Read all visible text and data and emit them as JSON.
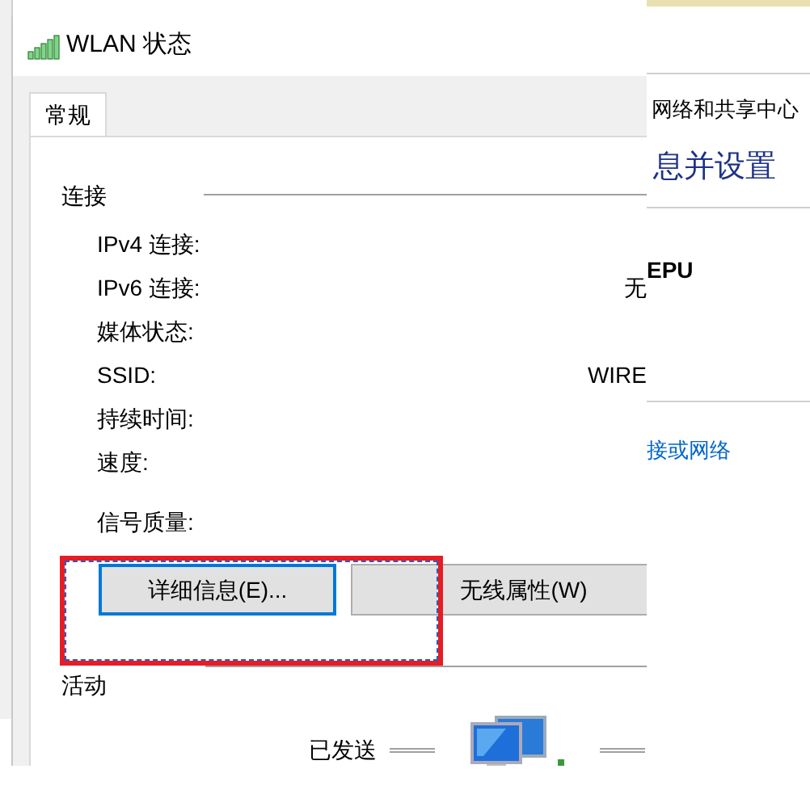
{
  "background_window": {
    "title_fragment": "网络和共享中心",
    "heading_fragment": "息并设置",
    "label_fragment": "EPU",
    "link_fragment": "接或网络"
  },
  "dialog": {
    "title": "WLAN 状态",
    "tabs": [
      {
        "label": "常规",
        "selected": true
      }
    ],
    "connection": {
      "heading": "连接",
      "rows": [
        {
          "label": "IPv4 连接:"
        },
        {
          "label": "IPv6 连接:",
          "value": "无"
        },
        {
          "label": "媒体状态:"
        },
        {
          "label": "SSID:",
          "value": "WIRE"
        },
        {
          "label": "持续时间:"
        },
        {
          "label": "速度:"
        },
        {
          "label": "信号质量:"
        }
      ]
    },
    "buttons": [
      {
        "label": "详细信息(E)...",
        "selected": true
      },
      {
        "label": "无线属性(W)",
        "selected": false
      }
    ],
    "activity": {
      "heading": "活动",
      "sent_label": "已发送"
    }
  },
  "annotation": {
    "kind": "highlight-box"
  }
}
